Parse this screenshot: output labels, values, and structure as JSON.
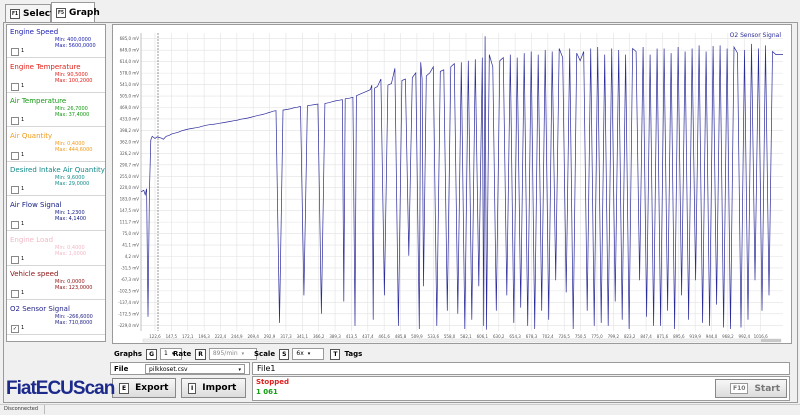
{
  "tabs": [
    {
      "key": "F1",
      "label": "Select"
    },
    {
      "key": "F5",
      "label": "Graph"
    }
  ],
  "signals": [
    {
      "name": "Engine Speed",
      "color": "#1e22b0",
      "min": "Min: 400,0000",
      "max": "Max: 5600,0000",
      "checked": false,
      "check_label": "1"
    },
    {
      "name": "Engine Temperature",
      "color": "#e0201a",
      "min": "Min: 90,5000",
      "max": "Max: 100,2000",
      "checked": false,
      "check_label": "1"
    },
    {
      "name": "Air Temperature",
      "color": "#119911",
      "min": "Min: 26,7000",
      "max": "Max: 37,4000",
      "checked": false,
      "check_label": "1"
    },
    {
      "name": "Air Quantity",
      "color": "#f29a1a",
      "min": "Min: 0,4000",
      "max": "Max: 444,6000",
      "checked": false,
      "check_label": "1"
    },
    {
      "name": "Desired Intake Air Quantity",
      "color": "#138a8a",
      "min": "Min: 9,6000",
      "max": "Max: 29,0000",
      "checked": false,
      "check_label": "1"
    },
    {
      "name": "Air Flow Signal",
      "color": "#101a80",
      "min": "Min: 1,2300",
      "max": "Max: 4,1400",
      "checked": false,
      "check_label": "1"
    },
    {
      "name": "Engine Load",
      "color": "#f3b8c6",
      "min": "Min: 0,4000",
      "max": "Max: 1,0000",
      "checked": false,
      "check_label": "1"
    },
    {
      "name": "Vehicle speed",
      "color": "#8a1010",
      "min": "Min: 0,0000",
      "max": "Max: 123,0000",
      "checked": false,
      "check_label": "1"
    },
    {
      "name": "O2 Sensor Signal",
      "color": "#24248a",
      "min": "Min: -266,6000",
      "max": "Max: 710,8000",
      "checked": true,
      "check_label": "1"
    }
  ],
  "chart_data": {
    "type": "line",
    "title": "O2 Sensor Signal",
    "color": "#2a2a9a",
    "yticks": [
      "-229,0 mV",
      "-172,5 mV",
      "-137,4 mV",
      "-102,5 mV",
      "-67,3 mV",
      "-31,5 mV",
      "4,2 mV",
      "41,1 mV",
      "75,0 mV",
      "111,7 mV",
      "147,5 mV",
      "183,0 mV",
      "220,0 mV",
      "255,0 mV",
      "290,7 mV",
      "326,2 mV",
      "362,0 mV",
      "398,2 mV",
      "433,0 mV",
      "469,0 mV",
      "505,0 mV",
      "541,0 mV",
      "578,0 mV",
      "614,0 mV",
      "649,0 mV",
      "685,0 mV"
    ],
    "ylim": [
      -266.6,
      710.8
    ],
    "xticks": [
      "122,6",
      "147,5",
      "172,1",
      "196,3",
      "222,4",
      "244,9",
      "269,4",
      "292,9",
      "317,3",
      "341,1",
      "366,2",
      "389,3",
      "413,5",
      "437,4",
      "461,6",
      "485,8",
      "509,9",
      "533,6",
      "558,0",
      "582,1",
      "606,1",
      "630,2",
      "654,3",
      "678,3",
      "702,4",
      "726,5",
      "750,5",
      "775,0",
      "799,2",
      "823,2",
      "847,4",
      "871,6",
      "895,6",
      "919,9",
      "944,0",
      "968,2",
      "992,4",
      "1016,6"
    ],
    "xlim": [
      112,
      1030
    ],
    "x": [
      112,
      116,
      118,
      120,
      122,
      124,
      126,
      128,
      130,
      132,
      135,
      138,
      141,
      144,
      148,
      152,
      156,
      160,
      165,
      170,
      175,
      180,
      185,
      190,
      195,
      200,
      205,
      210,
      215,
      220,
      225,
      230,
      235,
      240,
      245,
      250,
      255,
      260,
      265,
      270,
      275,
      280,
      285,
      290,
      295,
      298,
      300,
      305,
      310,
      315,
      320,
      325,
      330,
      335,
      340,
      345,
      350,
      355,
      360,
      365,
      370,
      375,
      380,
      385,
      390,
      395,
      400,
      402,
      404,
      410,
      415,
      418,
      420,
      425,
      430,
      435,
      440,
      442,
      444,
      446,
      450,
      455,
      460,
      465,
      470,
      475,
      480,
      485,
      490,
      495,
      500,
      505,
      510,
      512,
      514,
      516,
      520,
      525,
      530,
      535,
      540,
      545,
      550,
      555,
      560,
      565,
      570,
      575,
      580,
      585,
      590,
      595,
      600,
      602,
      604,
      606,
      610,
      615,
      620,
      625,
      630,
      635,
      640,
      645,
      650,
      655,
      660,
      665,
      670,
      675,
      680,
      685,
      690,
      695,
      700,
      705,
      710,
      715,
      720,
      725,
      730,
      735,
      740,
      745,
      750,
      755,
      760,
      765,
      770,
      775,
      780,
      785,
      790,
      795,
      800,
      805,
      810,
      815,
      820,
      825,
      830,
      835,
      840,
      845,
      850,
      855,
      860,
      865,
      870,
      875,
      880,
      885,
      890,
      895,
      900,
      905,
      910,
      915,
      920,
      925,
      930,
      935,
      940,
      945,
      950,
      955,
      960,
      965,
      970,
      975,
      980,
      985,
      990,
      995,
      1000,
      1005,
      1010,
      1015,
      1020,
      1025,
      1030
    ],
    "y": [
      190,
      195,
      180,
      200,
      -220,
      185,
      360,
      372,
      368,
      365,
      370,
      368,
      366,
      362,
      372,
      375,
      380,
      382,
      385,
      390,
      393,
      396,
      398,
      400,
      402,
      405,
      408,
      410,
      411,
      413,
      415,
      417,
      419,
      421,
      423,
      425,
      428,
      430,
      432,
      435,
      438,
      441,
      443,
      446,
      450,
      452,
      454,
      456,
      -240,
      458,
      460,
      462,
      465,
      467,
      470,
      -150,
      472,
      474,
      476,
      478,
      -210,
      480,
      482,
      485,
      488,
      490,
      492,
      -170,
      495,
      497,
      500,
      -250,
      505,
      510,
      515,
      520,
      525,
      540,
      -230,
      530,
      535,
      560,
      -150,
      540,
      545,
      595,
      -250,
      555,
      560,
      -20,
      565,
      580,
      -260,
      615,
      560,
      -120,
      570,
      580,
      600,
      -250,
      585,
      590,
      -200,
      600,
      610,
      -210,
      615,
      -260,
      620,
      -230,
      625,
      -120,
      630,
      -250,
      700,
      -262,
      640,
      600,
      -200,
      620,
      630,
      -150,
      640,
      -240,
      630,
      -190,
      645,
      -250,
      650,
      -260,
      640,
      -200,
      655,
      -230,
      650,
      -100,
      660,
      630,
      -140,
      660,
      -260,
      645,
      620,
      650,
      -200,
      660,
      -250,
      665,
      -240,
      640,
      -250,
      660,
      -170,
      655,
      -230,
      640,
      -260,
      660,
      650,
      -100,
      665,
      -220,
      640,
      -250,
      660,
      -250,
      660,
      -200,
      645,
      -260,
      665,
      -150,
      650,
      -230,
      660,
      -100,
      670,
      -240,
      650,
      -250,
      668,
      -180,
      670,
      -255,
      660,
      -260,
      665,
      645,
      -255,
      655,
      -230,
      675,
      -100,
      660,
      -200,
      670,
      -150,
      650,
      640
    ]
  },
  "controls": {
    "graphs_label": "Graphs",
    "graphs_key": "G",
    "graphs_value": "1",
    "rate_label": "Rate",
    "rate_key": "R",
    "rate_value": "895/min",
    "scale_label": "Scale",
    "scale_key": "S",
    "scale_value": "6x",
    "tags_key": "T",
    "tags_label": "Tags"
  },
  "file": {
    "label": "File",
    "value": "pilkkoset.csv",
    "display_name": "File1",
    "status": "Stopped",
    "count": "1 061"
  },
  "buttons": {
    "export_key": "E",
    "export_label": "Export",
    "import_key": "I",
    "import_label": "Import",
    "start_key": "F10",
    "start_label": "Start"
  },
  "brand": {
    "logo": "FiatECUScan"
  },
  "statusbar": {
    "text": "Disconnected"
  }
}
